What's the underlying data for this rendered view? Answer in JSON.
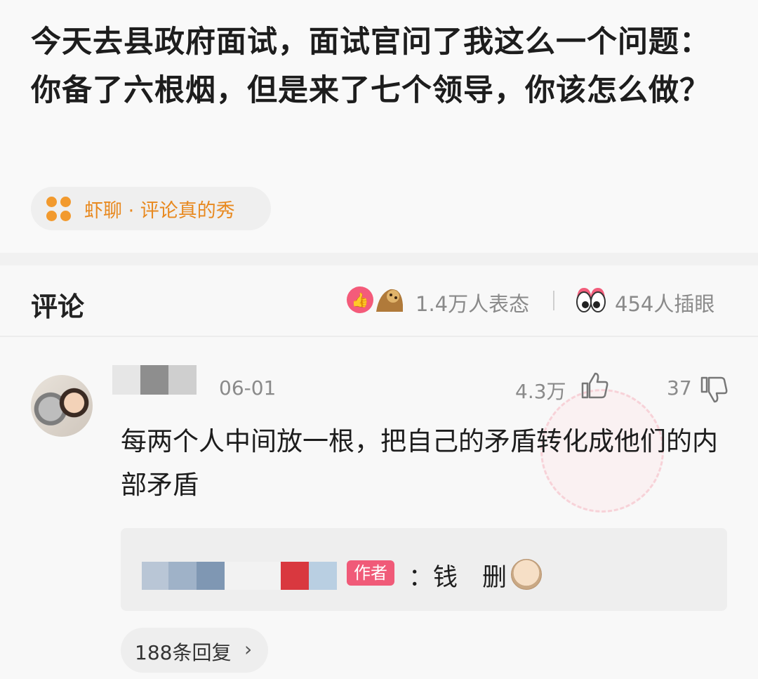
{
  "post": {
    "title": "今天去县政府面试，面试官问了我这么一个问题：你备了六根烟，但是来了七个领导，你该怎么做？",
    "topic": "虾聊 · 评论真的秀",
    "topic_icon": "four-dots-icon"
  },
  "comments_section": {
    "title": "评论",
    "reactions_count": "1.4万人表态",
    "eyes_count": "454人插眼"
  },
  "comment": {
    "date": "06-01",
    "likes": "4.3万",
    "dislikes": "37",
    "text": "每两个人中间放一根，把自己的矛盾转化成他们的内部矛盾",
    "reply": {
      "author_badge": "作者",
      "text": "：钱　删"
    },
    "replies_link": "188条回复"
  },
  "colors": {
    "accent_orange": "#e8891f",
    "badge_pink": "#f05a78",
    "muted_text": "#8a8a8a"
  }
}
